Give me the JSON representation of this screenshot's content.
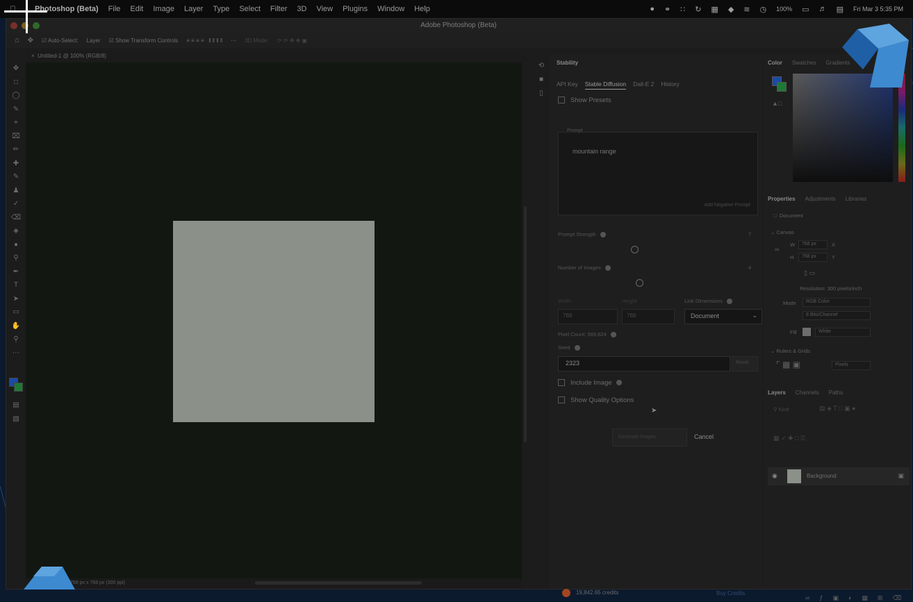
{
  "menubar": {
    "app_name": "Photoshop (Beta)",
    "items": [
      "File",
      "Edit",
      "Image",
      "Layer",
      "Type",
      "Select",
      "Filter",
      "3D",
      "View",
      "Plugins",
      "Window",
      "Help"
    ],
    "battery": "100%",
    "datetime": "Fri Mar 3  5:35 PM"
  },
  "window": {
    "title": "Adobe Photoshop (Beta)"
  },
  "options_bar": {
    "auto_select_label": "Auto-Select:",
    "auto_select_value": "Layer",
    "transform_label": "Show Transform Controls",
    "mode_label": "3D Mode:"
  },
  "document_tab": {
    "title": "Untitled-1 @ 100% (RGB/8)"
  },
  "status_bar": {
    "text": "768 px x 768 px (300 ppi)"
  },
  "plugin": {
    "name": "Stability",
    "tabs": [
      "API Key",
      "Stable Diffusion",
      "Dall-E 2",
      "History"
    ],
    "active_tab": "Stable Diffusion",
    "show_presets_label": "Show Presets",
    "prompt_label": "Prompt",
    "prompt_value": "mountain range",
    "negative_label": "Add Negative Prompt",
    "prompt_strength_label": "Prompt Strength",
    "prompt_strength_value": "7",
    "num_images_label": "Number of Images",
    "num_images_value": "4",
    "width_label": "Width",
    "width_value": "768",
    "height_label": "Height",
    "height_value": "768",
    "link_label": "Link Dimensions",
    "link_value": "Document",
    "pixel_count_label": "Pixel Count: 589,824",
    "seed_label": "Seed",
    "seed_value": "2323",
    "seed_button": "Reset",
    "include_image_label": "Include Image",
    "quality_label": "Show Quality Options",
    "generate_label": "Generate Images",
    "cancel_label": "Cancel",
    "credits": "19,842.65 credits",
    "buy_credits": "Buy Credits"
  },
  "right_panel": {
    "color_tabs": [
      "Color",
      "Swatches",
      "Gradients"
    ],
    "props_tabs": [
      "Properties",
      "Adjustments",
      "Libraries"
    ],
    "doc_label": "Document",
    "canvas_section": "Canvas",
    "w_value": "768 px",
    "h_value": "768 px",
    "x_label": "X",
    "y_label": "Y",
    "resolution": "Resolution: 300 pixels/inch",
    "mode_label": "Mode",
    "mode_value": "RGB Color",
    "bits_value": "8 Bits/Channel",
    "fill_label": "Fill",
    "fill_value": "White",
    "rulers_section": "Rulers & Grids",
    "rulers_unit": "Pixels",
    "layers_tabs": [
      "Layers",
      "Channels",
      "Paths"
    ],
    "kind_label": "Kind",
    "layer_name": "Background"
  },
  "colors": {
    "fg": "#1b4aa6",
    "bg": "#1d7a34",
    "canvas_fill": "#8b9089",
    "accent_cube": "#4a8fcf"
  }
}
